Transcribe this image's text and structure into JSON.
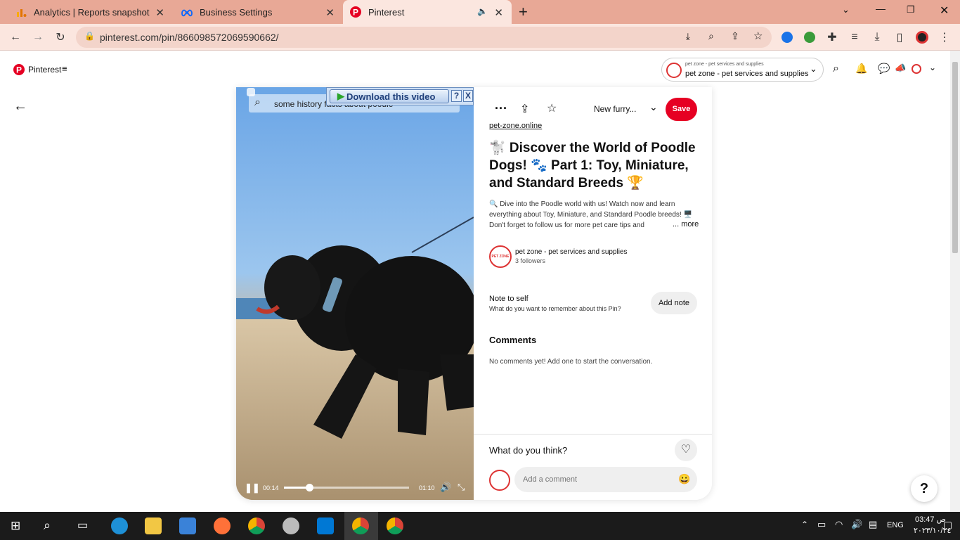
{
  "browser": {
    "tabs": [
      {
        "title": "Analytics | Reports snapshot",
        "close": "✕"
      },
      {
        "title": "Business Settings",
        "close": "✕"
      },
      {
        "title": "Pinterest",
        "close": "✕"
      }
    ],
    "new_tab": "+",
    "url": "pinterest.com/pin/866098572069590662/"
  },
  "header": {
    "brand": "Pinterest",
    "account_small": "pet zone - pet services and supplies",
    "account_name": "pet zone - pet services and supplies"
  },
  "video": {
    "search_overlay": "some history facts about poodle",
    "download_label": "Download this video",
    "help": "?",
    "close": "X",
    "current_time": "00:14",
    "duration": "01:10",
    "progress": 0.2
  },
  "pin": {
    "board": "New furry...",
    "save_label": "Save",
    "source_link": "pet-zone.online",
    "title": "🐩 Discover the World of Poodle Dogs! 🐾 Part 1: Toy, Miniature, and Standard Breeds 🏆",
    "description": "🔍 Dive into the Poodle world with us! Watch now and learn everything about Toy, Miniature, and Standard Poodle breeds! 🖥️ Don't forget to follow us for more pet care tips and",
    "more": "... more",
    "creator": {
      "name": "pet zone - pet services and supplies",
      "followers": "3 followers",
      "avatar_text": "PET ZONE"
    },
    "note_title": "Note to self",
    "note_sub": "What do you want to remember about this Pin?",
    "add_note": "Add note",
    "comments_title": "Comments",
    "comments_empty": "No comments yet! Add one to start the conversation.",
    "what_think": "What do you think?",
    "comment_placeholder": "Add a comment"
  },
  "help_button": "?",
  "taskbar": {
    "lang": "ENG",
    "time": "03:47 ص",
    "date": "٢٠٢٣/١٠/٢٤"
  }
}
